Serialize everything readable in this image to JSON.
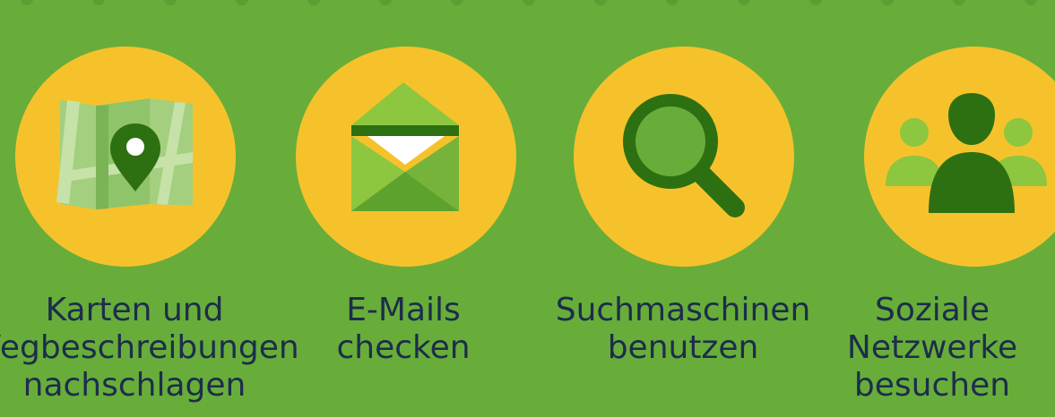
{
  "items": [
    {
      "icon": "map-pin-icon",
      "label": "Karten und\nWegbeschreibungen\nnachschlagen"
    },
    {
      "icon": "envelope-icon",
      "label": "E-Mails\nchecken"
    },
    {
      "icon": "magnifier-icon",
      "label": "Suchmaschinen\nbenutzen"
    },
    {
      "icon": "people-icon",
      "label": "Soziale\nNetzwerke\nbesuchen"
    }
  ],
  "colors": {
    "background": "#68ad3a",
    "circle": "#f6c22b",
    "text": "#1c2d4b",
    "dark_green": "#2d7012"
  }
}
